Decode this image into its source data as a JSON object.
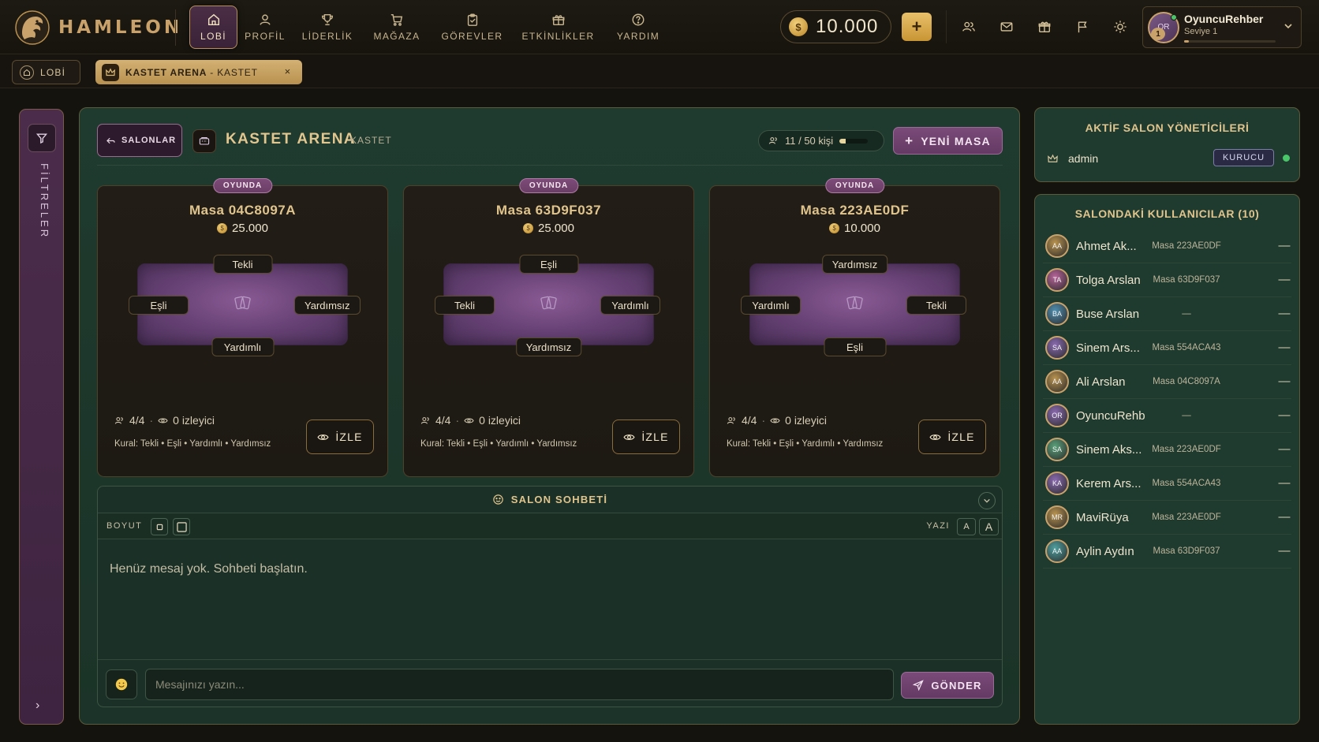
{
  "brand": {
    "name": "HAMLEON"
  },
  "nav": {
    "items": [
      {
        "label": "LOBİ",
        "icon": "home-icon",
        "active": true
      },
      {
        "label": "PROFİL",
        "icon": "user-icon",
        "active": false
      },
      {
        "label": "LİDERLİK",
        "icon": "trophy-icon",
        "active": false
      },
      {
        "label": "MAĞAZA",
        "icon": "cart-icon",
        "active": false
      },
      {
        "label": "GÖREVLER",
        "icon": "clipboard-icon",
        "active": false
      },
      {
        "label": "ETKİNLİKLER",
        "icon": "gift-box-icon",
        "active": false
      },
      {
        "label": "YARDIM",
        "icon": "help-icon",
        "active": false
      }
    ]
  },
  "wallet": {
    "coin_symbol": "$",
    "balance": "10.000",
    "add_label": "+"
  },
  "user": {
    "avatar_text": "OR",
    "name": "OyuncuRehber",
    "level_text": "Seviye 1",
    "level_badge": "1",
    "xp_progress": 0.05
  },
  "tabs": {
    "lobby_label": "LOBİ",
    "arena_name": "KASTET ARENA",
    "arena_sep": " - ",
    "arena_game": "KASTET",
    "close": "×"
  },
  "filters": {
    "label": "FİLTRELER",
    "expand": "›"
  },
  "salon": {
    "back_label": "SALONLAR",
    "title": "KASTET ARENA",
    "subtitle": "KASTET",
    "capacity_text": "11 / 50 kişi",
    "capacity_fraction": 0.22,
    "new_table_label": "YENİ MASA"
  },
  "tables": [
    {
      "status": "OYUNDA",
      "name": "Masa 04C8097A",
      "bet": "25.000",
      "seats": {
        "top": "Tekli",
        "left": "Eşli",
        "right": "Yardımsız",
        "bottom": "Yardımlı"
      },
      "players": "4/4",
      "spectators": "0 izleyici",
      "rule_prefix": "Kural:",
      "rules": "Tekli • Eşli • Yardımlı • Yardımsız",
      "watch_label": "İZLE"
    },
    {
      "status": "OYUNDA",
      "name": "Masa 63D9F037",
      "bet": "25.000",
      "seats": {
        "top": "Eşli",
        "left": "Tekli",
        "right": "Yardımlı",
        "bottom": "Yardımsız"
      },
      "players": "4/4",
      "spectators": "0 izleyici",
      "rule_prefix": "Kural:",
      "rules": "Tekli • Eşli • Yardımlı • Yardımsız",
      "watch_label": "İZLE"
    },
    {
      "status": "OYUNDA",
      "name": "Masa 223AE0DF",
      "bet": "10.000",
      "seats": {
        "top": "Yardımsız",
        "left": "Yardımlı",
        "right": "Tekli",
        "bottom": "Eşli"
      },
      "players": "4/4",
      "spectators": "0 izleyici",
      "rule_prefix": "Kural:",
      "rules": "Tekli • Eşli • Yardımlı • Yardımsız",
      "watch_label": "İZLE"
    }
  ],
  "chat": {
    "title": "SALON SOHBETİ",
    "size_label": "BOYUT",
    "font_label": "YAZI",
    "font_small": "A",
    "font_large": "A",
    "empty_text": "Henüz mesaj yok. Sohbeti başlatın.",
    "input_placeholder": "Mesajınızı yazın...",
    "send_label": "GÖNDER"
  },
  "admins": {
    "title": "AKTİF SALON YÖNETİCİLERİ",
    "list": [
      {
        "name": "admin",
        "role": "KURUCU",
        "online": true
      }
    ]
  },
  "users": {
    "title": "SALONDAKİ KULLANICILAR (10)",
    "list": [
      {
        "initials": "AA",
        "name": "Ahmet Ak...",
        "table": "Masa 223AE0DF",
        "action": "—",
        "color": "#b9934f"
      },
      {
        "initials": "TA",
        "name": "Tolga Arslan",
        "table": "Masa 63D9F037",
        "action": "—",
        "color": "#b8649a"
      },
      {
        "initials": "BA",
        "name": "Buse Arslan",
        "table": "—",
        "action": "—",
        "color": "#4f8fb0"
      },
      {
        "initials": "SA",
        "name": "Sinem Ars...",
        "table": "Masa 554ACA43",
        "action": "—",
        "color": "#8a6ab0"
      },
      {
        "initials": "AA",
        "name": "Ali Arslan",
        "table": "Masa 04C8097A",
        "action": "—",
        "color": "#b9934f"
      },
      {
        "initials": "OR",
        "name": "OyuncuRehber",
        "table": "—",
        "action": "—",
        "color": "#8a6ab0"
      },
      {
        "initials": "SA",
        "name": "Sinem Aks...",
        "table": "Masa 223AE0DF",
        "action": "—",
        "color": "#5aa07a"
      },
      {
        "initials": "KA",
        "name": "Kerem Ars...",
        "table": "Masa 554ACA43",
        "action": "—",
        "color": "#8a6ab0"
      },
      {
        "initials": "MR",
        "name": "MaviRüya",
        "table": "Masa 223AE0DF",
        "action": "—",
        "color": "#b9934f"
      },
      {
        "initials": "AA",
        "name": "Aylin Aydın",
        "table": "Masa 63D9F037",
        "action": "—",
        "color": "#4fa0a0"
      }
    ]
  },
  "colors": {
    "gold": "#e0c48d",
    "felt": "#6a4478",
    "panel": "#1f3a2e",
    "accent_purple": "#7a4a78"
  }
}
